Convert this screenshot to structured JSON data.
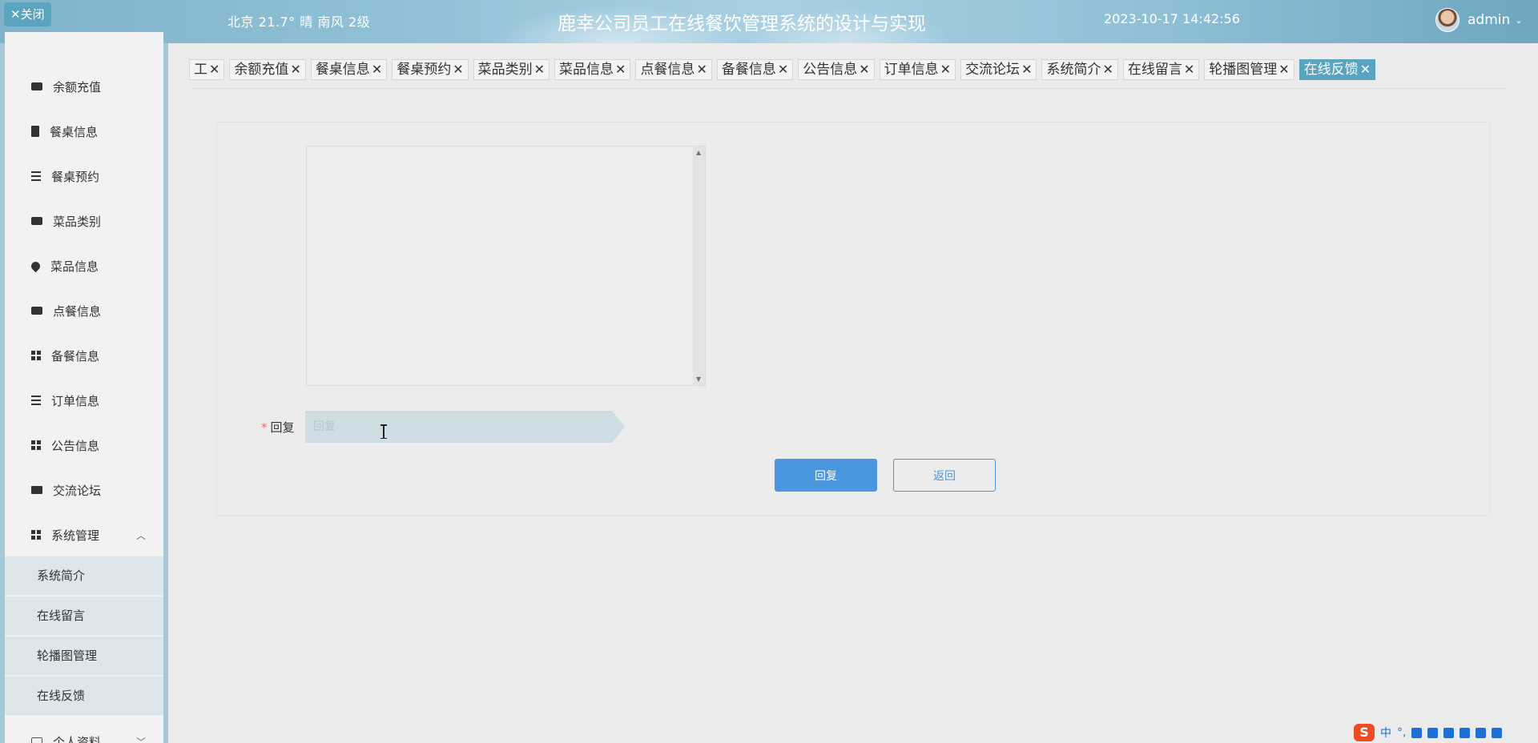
{
  "header": {
    "close_label": "✕关闭",
    "weather": "北京  21.7°  晴  南风  2级",
    "title": "鹿幸公司员工在线餐饮管理系统的设计与实现",
    "datetime": "2023-10-17 14:42:56",
    "username": "admin",
    "caret": "⌄"
  },
  "sidebar": {
    "items": [
      {
        "label": "余额充值",
        "icon": "message-icon"
      },
      {
        "label": "餐桌信息",
        "icon": "clipboard-icon"
      },
      {
        "label": "餐桌预约",
        "icon": "list-icon"
      },
      {
        "label": "菜品类别",
        "icon": "card-icon"
      },
      {
        "label": "菜品信息",
        "icon": "location-pin-icon"
      },
      {
        "label": "点餐信息",
        "icon": "wallet-icon"
      },
      {
        "label": "备餐信息",
        "icon": "grid-icon"
      },
      {
        "label": "订单信息",
        "icon": "lines-icon"
      },
      {
        "label": "公告信息",
        "icon": "grid-icon"
      },
      {
        "label": "交流论坛",
        "icon": "monitor-icon"
      },
      {
        "label": "系统管理",
        "icon": "grid-icon",
        "arrow": "︿"
      },
      {
        "label": "个人资料",
        "icon": "id-card-icon",
        "arrow": "﹀"
      }
    ],
    "subitems": [
      "系统简介",
      "在线留言",
      "轮播图管理",
      "在线反馈"
    ]
  },
  "tabs": [
    {
      "label": "工"
    },
    {
      "label": "余额充值"
    },
    {
      "label": "餐桌信息"
    },
    {
      "label": "餐桌预约"
    },
    {
      "label": "菜品类别"
    },
    {
      "label": "菜品信息"
    },
    {
      "label": "点餐信息"
    },
    {
      "label": "备餐信息"
    },
    {
      "label": "公告信息"
    },
    {
      "label": "订单信息"
    },
    {
      "label": "交流论坛"
    },
    {
      "label": "系统简介"
    },
    {
      "label": "在线留言"
    },
    {
      "label": "轮播图管理"
    },
    {
      "label": "在线反馈",
      "active": true
    }
  ],
  "tab_close": "✕",
  "form": {
    "content_value": "",
    "reply_label": "回复",
    "required_mark": "*",
    "reply_placeholder": "回复",
    "reply_value": "",
    "submit_label": "回复",
    "back_label": "返回",
    "scroll_up": "▲",
    "scroll_down": "▼"
  },
  "tray": {
    "ime_logo": "S",
    "ime_mode": "中",
    "punct": "°,"
  },
  "colors": {
    "accent": "#5ba4bf",
    "primary_button": "#4a97e0",
    "required": "#f56c6c"
  }
}
